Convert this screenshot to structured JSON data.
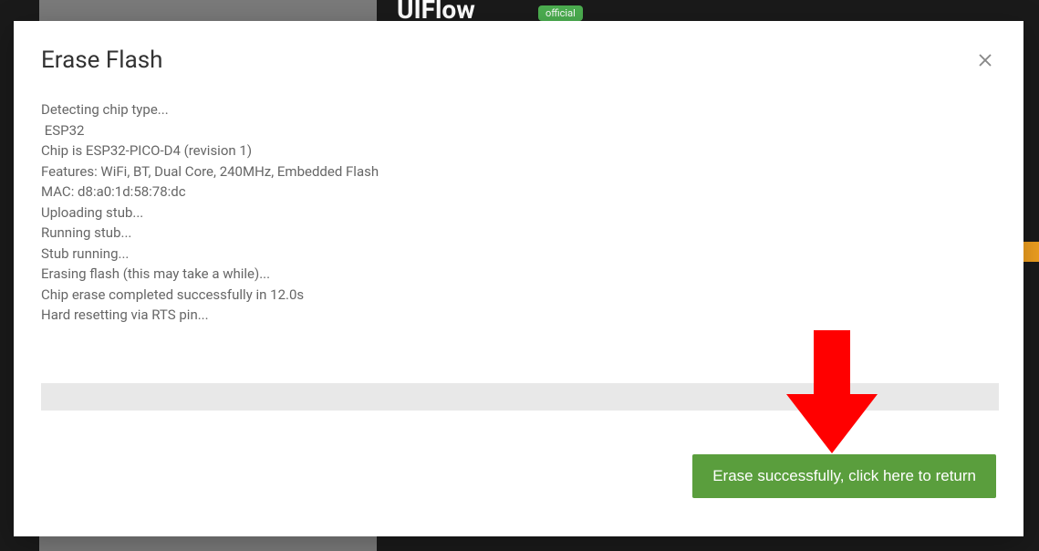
{
  "background": {
    "app_title": "UIFlow",
    "badge": "official"
  },
  "modal": {
    "title": "Erase Flash",
    "log_lines": [
      "Detecting chip type...",
      " ESP32",
      "Chip is ESP32-PICO-D4 (revision 1)",
      "Features: WiFi, BT, Dual Core, 240MHz, Embedded Flash",
      "MAC: d8:a0:1d:58:78:dc",
      "Uploading stub...",
      "Running stub...",
      "Stub running...",
      "Erasing flash (this may take a while)...",
      "Chip erase completed successfully in 12.0s",
      "Hard resetting via RTS pin..."
    ],
    "return_button": "Erase successfully, click here to return"
  }
}
